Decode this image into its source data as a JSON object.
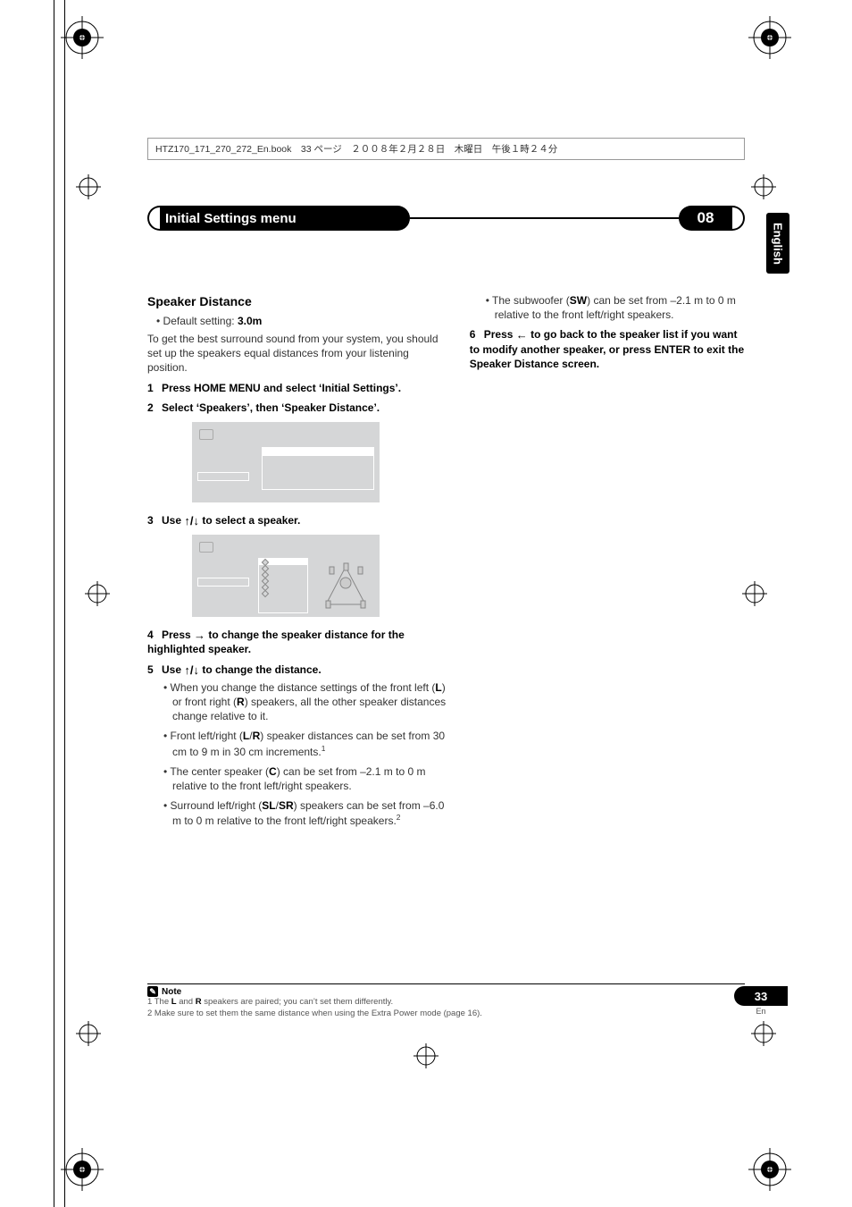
{
  "header_strip": "HTZ170_171_270_272_En.book　33 ページ　２００８年２月２８日　木曜日　午後１時２４分",
  "chapter": {
    "title": "Initial Settings menu",
    "number": "08"
  },
  "side_tab": "English",
  "page_number": "33",
  "page_lang": "En",
  "h3": "Speaker Distance",
  "default_bullet": "Default setting: ",
  "default_value": "3.0m",
  "intro": "To get the best surround sound from your system, you should set up the speakers equal distances from your listening position.",
  "step1": {
    "n": "1",
    "text": "Press HOME MENU and select ‘Initial Settings’."
  },
  "step2": {
    "n": "2",
    "text": "Select ‘Speakers’, then ‘Speaker Distance’."
  },
  "step3": {
    "n": "3",
    "pre": "Use ",
    "post": " to select a speaker."
  },
  "step4": {
    "n": "4",
    "pre": "Press ",
    "post": " to change the speaker distance for the highlighted speaker."
  },
  "step5": {
    "n": "5",
    "pre": "Use ",
    "post": " to change the distance."
  },
  "sb1a": "When you change the distance settings of the front left (",
  "sb1_l": "L",
  "sb1b": ") or front right (",
  "sb1_r": "R",
  "sb1c": ") speakers, all the other speaker distances change relative to it.",
  "sb2a": "Front left/right (",
  "sb2_lr": "L",
  "sb2_sep": "/",
  "sb2_r": "R",
  "sb2b": ") speaker distances can be set from 30 cm to 9 m in 30 cm increments.",
  "sb2_sup": "1",
  "sb3a": "The center speaker (",
  "sb3_c": "C",
  "sb3b": ") can be set from –2.1 m to 0 m relative to the front left/right speakers.",
  "sb4a": "Surround left/right (",
  "sb4_sl": "SL",
  "sb4_sep": "/",
  "sb4_sr": "SR",
  "sb4b": ") speakers can be set from –6.0 m to 0 m relative to the front left/right speakers.",
  "sb4_sup": "2",
  "sb5a": "The subwoofer (",
  "sb5_sw": "SW",
  "sb5b": ") can be set from –2.1 m to 0 m relative to the front left/right speakers.",
  "step6": {
    "n": "6",
    "pre": "Press ",
    "post": " to go back to the speaker list if you want to modify another speaker, or press ENTER to exit the Speaker Distance screen."
  },
  "note_label": "Note",
  "note1": "1 The L and R speakers are paired; you can’t set them differently.",
  "note1_b1": "L",
  "note1_b2": "R",
  "note1_pre": "1 The ",
  "note1_mid": " and ",
  "note1_post": " speakers are paired; you can’t set them differently.",
  "note2": "2 Make sure to set them the same distance when using the Extra Power mode (page 16).",
  "glyph_updown": "↑/↓",
  "glyph_right": "→",
  "glyph_left": "←"
}
